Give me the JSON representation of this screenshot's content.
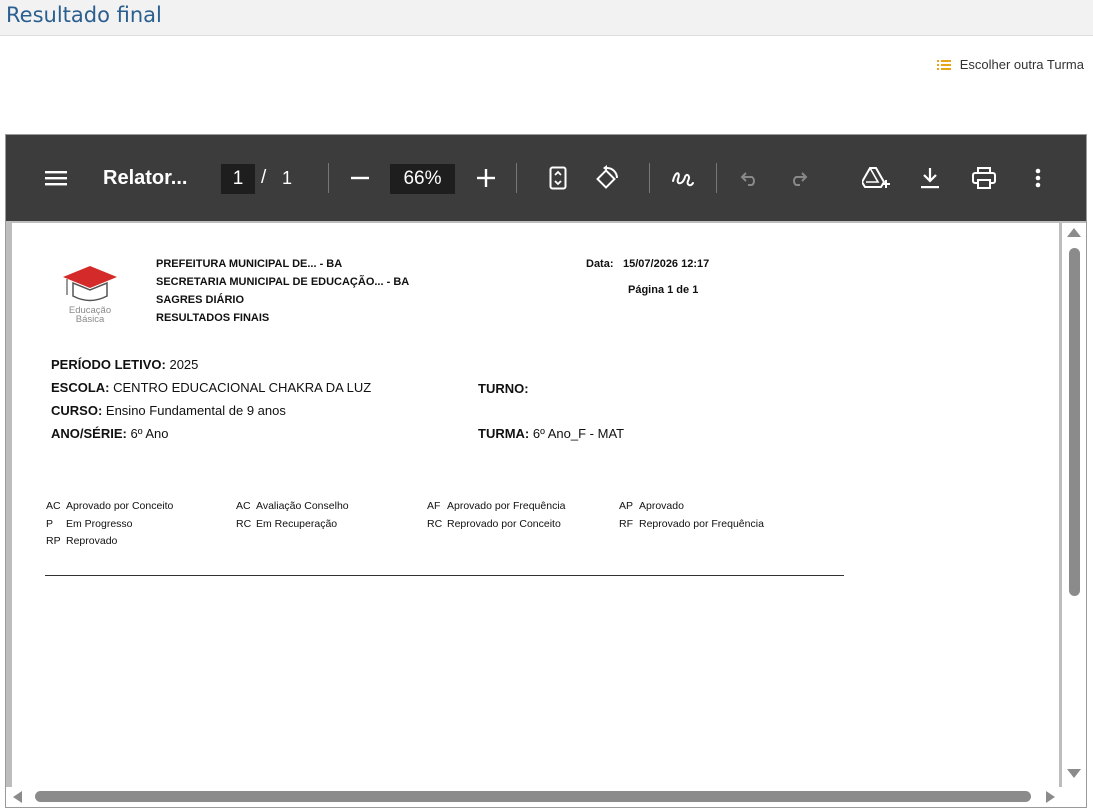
{
  "header": {
    "title": "Resultado final"
  },
  "actions": {
    "choose_class_label": "Escolher outra Turma"
  },
  "viewer": {
    "doc_title": "Relator...",
    "page_current": "1",
    "page_separator": "/",
    "page_total": "1",
    "zoom": "66%"
  },
  "report": {
    "header_lines": [
      "PREFEITURA MUNICIPAL DE... - BA",
      "SECRETARIA MUNICIPAL DE EDUCAÇÃO... - BA",
      "SAGRES DIÁRIO",
      "RESULTADOS FINAIS"
    ],
    "logo_text_1": "Educação",
    "logo_text_2": "Básica",
    "date_label": "Data:",
    "date_value": "15/07/2026 12:17",
    "page_info": "Página 1 de 1",
    "fields": {
      "periodo_label": "PERÍODO LETIVO:",
      "periodo_value": "2025",
      "escola_label": "ESCOLA:",
      "escola_value": "CENTRO EDUCACIONAL CHAKRA DA LUZ",
      "turno_label": "TURNO:",
      "turno_value": "",
      "curso_label": "CURSO:",
      "curso_value": "Ensino Fundamental de 9 anos",
      "ano_label": "ANO/SÉRIE:",
      "ano_value": "6º Ano",
      "turma_label": "TURMA:",
      "turma_value": "6º Ano_F - MAT"
    },
    "legend": [
      {
        "code": "AC",
        "label": "Aprovado por Conceito"
      },
      {
        "code": "AC",
        "label": "Avaliação Conselho"
      },
      {
        "code": "AF",
        "label": "Aprovado por Frequência"
      },
      {
        "code": "AP",
        "label": "Aprovado"
      },
      {
        "code": "P",
        "label": "Em Progresso"
      },
      {
        "code": "RC",
        "label": "Em Recuperação"
      },
      {
        "code": "RC",
        "label": "Reprovado por Conceito"
      },
      {
        "code": "RF",
        "label": "Reprovado por Frequência"
      },
      {
        "code": "RP",
        "label": "Reprovado"
      }
    ]
  },
  "colors": {
    "title": "#2a5f8f",
    "toolbar": "#3c3c3c",
    "accent_icon": "#e8a317",
    "logo_red": "#d42a2a"
  }
}
